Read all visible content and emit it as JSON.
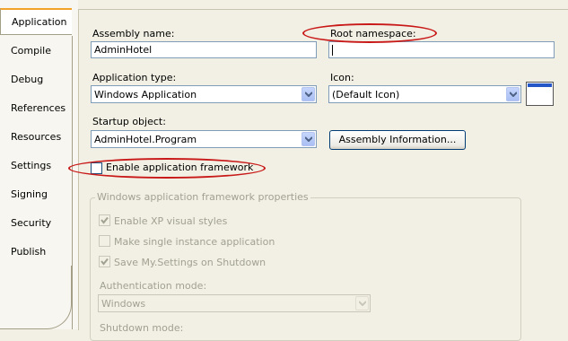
{
  "tabs": [
    "Application",
    "Compile",
    "Debug",
    "References",
    "Resources",
    "Settings",
    "Signing",
    "Security",
    "Publish"
  ],
  "assembly_name": {
    "label": "Assembly name:",
    "value": "AdminHotel"
  },
  "root_namespace": {
    "label": "Root namespace:",
    "value": ""
  },
  "application_type": {
    "label": "Application type:",
    "value": "Windows Application"
  },
  "icon": {
    "label": "Icon:",
    "value": "(Default Icon)"
  },
  "startup_object": {
    "label": "Startup object:",
    "value": "AdminHotel.Program"
  },
  "assembly_info_button": "Assembly Information...",
  "enable_framework": {
    "label": "Enable application framework",
    "checked": false
  },
  "framework_props": {
    "caption": "Windows application framework properties",
    "enable_xp_styles": {
      "label": "Enable XP visual styles",
      "checked": true
    },
    "single_instance": {
      "label": "Make single instance application",
      "checked": false
    },
    "save_settings": {
      "label": "Save My.Settings on Shutdown",
      "checked": true
    },
    "auth_mode": {
      "label": "Authentication mode:",
      "value": "Windows"
    },
    "shutdown_mode": {
      "label": "Shutdown mode:"
    }
  },
  "colors": {
    "annotation": "#c81818",
    "active_tab_accent": "#f0a22a",
    "input_border": "#7f9db9"
  }
}
